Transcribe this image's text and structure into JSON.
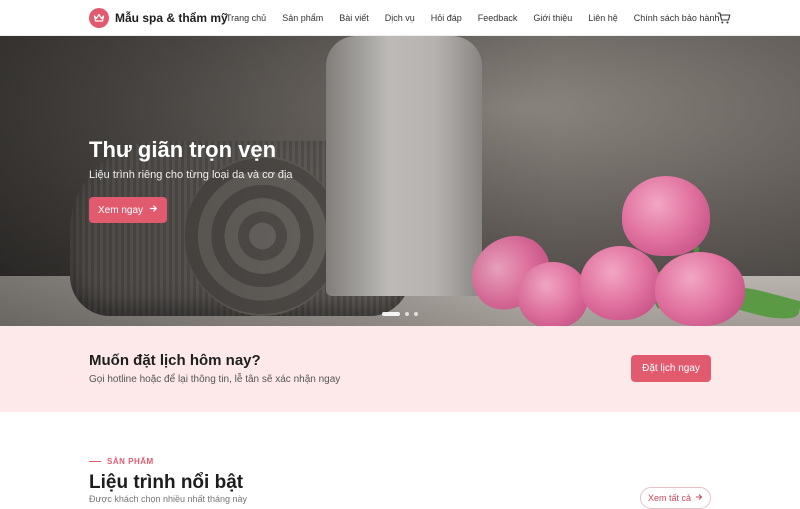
{
  "brand": {
    "name": "Mẫu spa & thẩm mỹ",
    "logo_icon": "crown-icon",
    "accent": "#e25a6e"
  },
  "nav": {
    "items": [
      {
        "label": "Trang chủ"
      },
      {
        "label": "Sản phẩm"
      },
      {
        "label": "Bài viết"
      },
      {
        "label": "Dịch vụ"
      },
      {
        "label": "Hỏi đáp"
      },
      {
        "label": "Feedback"
      },
      {
        "label": "Giới thiệu"
      },
      {
        "label": "Liên hệ"
      },
      {
        "label": "Chính sách bảo hành"
      }
    ],
    "cart_icon": "cart-icon"
  },
  "hero": {
    "title": "Thư giãn trọn vẹn",
    "subtitle": "Liệu trình riêng cho từng loại da và cơ địa",
    "button_label": "Xem ngay",
    "button_icon": "arrow-right-icon",
    "slides_total": 3,
    "active_slide": 1
  },
  "cta": {
    "title": "Muốn đặt lịch hôm nay?",
    "subtitle": "Gọi hotline hoặc để lại thông tin, lễ tân sẽ xác nhận ngay",
    "button_label": "Đặt lịch ngay",
    "background": "#fde9ea"
  },
  "products": {
    "eyebrow": "SẢN PHẨM",
    "title": "Liệu trình nổi bật",
    "subtitle": "Được khách chọn nhiều nhất tháng này",
    "view_all_label": "Xem tất cả",
    "view_all_icon": "arrow-right-icon"
  }
}
